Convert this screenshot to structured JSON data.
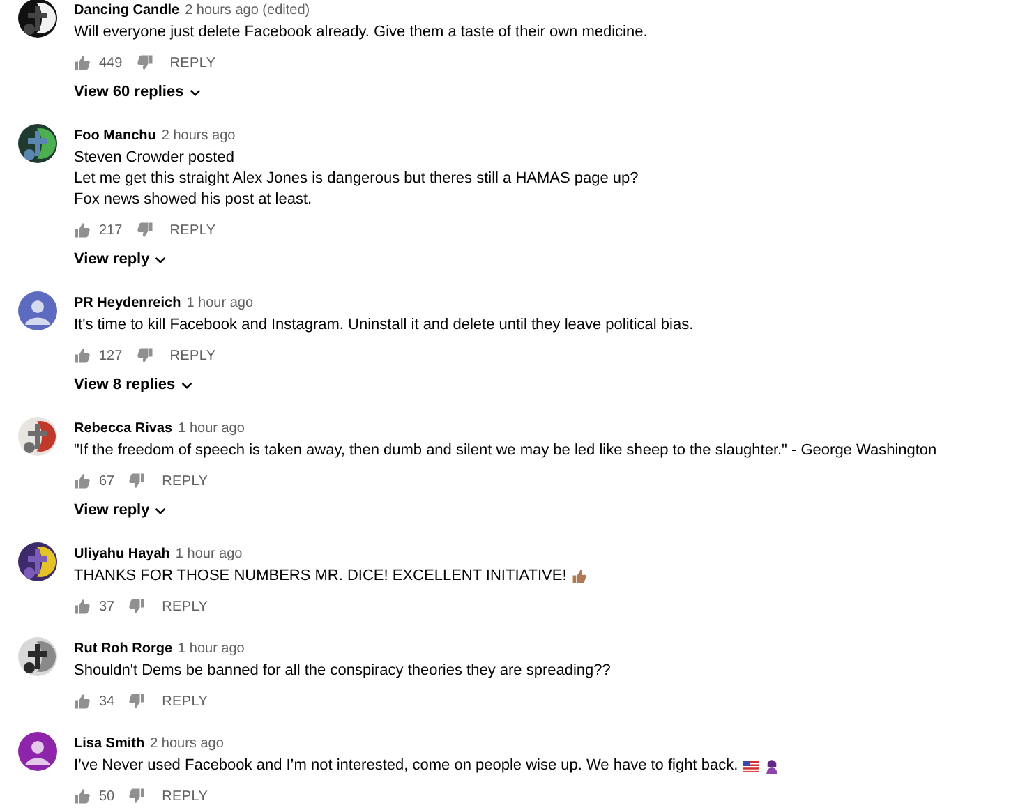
{
  "comments": [
    {
      "author": "Dancing Candle",
      "time": "2 hours ago (edited)",
      "avatar": {
        "kind": "picture"
      },
      "lines": [
        "Will everyone just delete Facebook already. Give them a taste of their own medicine."
      ],
      "likes": "449",
      "reply": "REPLY",
      "replies": "View 60 replies"
    },
    {
      "author": "Foo Manchu",
      "time": "2 hours ago",
      "avatar": {
        "kind": "picture"
      },
      "lines": [
        "Steven Crowder posted",
        "Let me get this straight Alex Jones is dangerous but theres still a HAMAS page up?",
        "Fox news showed his post at least."
      ],
      "likes": "217",
      "reply": "REPLY",
      "replies": "View reply"
    },
    {
      "author": "PR Heydenreich",
      "time": "1 hour ago",
      "avatar": {
        "kind": "default",
        "color": "#5c6bc0"
      },
      "lines": [
        "It's time to kill Facebook and Instagram. Uninstall it and delete until they leave political bias."
      ],
      "likes": "127",
      "reply": "REPLY",
      "replies": "View 8 replies"
    },
    {
      "author": "Rebecca Rivas",
      "time": "1 hour ago",
      "avatar": {
        "kind": "picture"
      },
      "lines": [
        "\"If the freedom of speech is taken away, then dumb and silent we may be led like sheep to the slaughter.\"   - George Washington"
      ],
      "likes": "67",
      "reply": "REPLY",
      "replies": "View reply"
    },
    {
      "author": "Uliyahu Hayah",
      "time": "1 hour ago",
      "avatar": {
        "kind": "picture"
      },
      "lines": [
        "THANKS FOR THOSE NUMBERS MR. DICE! EXCELLENT INITIATIVE!"
      ],
      "trailing_icons": [
        {
          "kind": "thumbs_up"
        }
      ],
      "likes": "37",
      "reply": "REPLY"
    },
    {
      "author": "Rut Roh Rorge",
      "time": "1 hour ago",
      "avatar": {
        "kind": "picture"
      },
      "lines": [
        "Shouldn't Dems be banned for all the conspiracy theories they are spreading??"
      ],
      "likes": "34",
      "reply": "REPLY"
    },
    {
      "author": "Lisa Smith",
      "time": "2 hours ago",
      "avatar": {
        "kind": "default",
        "color": "#8e24aa"
      },
      "lines": [
        "I’ve Never used Facebook and I’m not interested, come on people wise up. We have to fight back."
      ],
      "trailing_icons": [
        {
          "kind": "flag"
        },
        {
          "kind": "person"
        }
      ],
      "likes": "50",
      "reply": "REPLY"
    }
  ]
}
